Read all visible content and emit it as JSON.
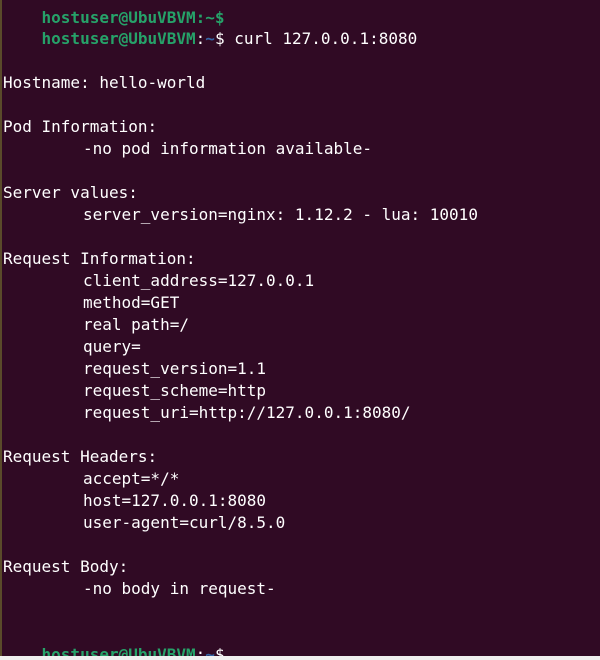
{
  "terminal": {
    "partial_top_prompt": "hostuser@UbuVBVM:~$",
    "prompt": {
      "user_host": "hostuser@UbuVBVM",
      "colon": ":",
      "path": "~",
      "symbol": "$"
    },
    "command": " curl 127.0.0.1:8080",
    "output": {
      "hostname": "Hostname: hello-world",
      "pod_info_header": "Pod Information:",
      "pod_info_value": "-no pod information available-",
      "server_values_header": "Server values:",
      "server_version": "server_version=nginx: 1.12.2 - lua: 10010",
      "request_info_header": "Request Information:",
      "client_address": "client_address=127.0.0.1",
      "method": "method=GET",
      "real_path": "real path=/",
      "query": "query=",
      "request_version": "request_version=1.1",
      "request_scheme": "request_scheme=http",
      "request_uri": "request_uri=http://127.0.0.1:8080/",
      "request_headers_header": "Request Headers:",
      "accept": "accept=*/*",
      "host": "host=127.0.0.1:8080",
      "user_agent": "user-agent=curl/8.5.0",
      "request_body_header": "Request Body:",
      "request_body_value": "-no body in request-"
    }
  },
  "colors": {
    "background": "#300a24",
    "prompt_user": "#26a269",
    "prompt_path": "#3465a4",
    "text": "#ffffff"
  }
}
